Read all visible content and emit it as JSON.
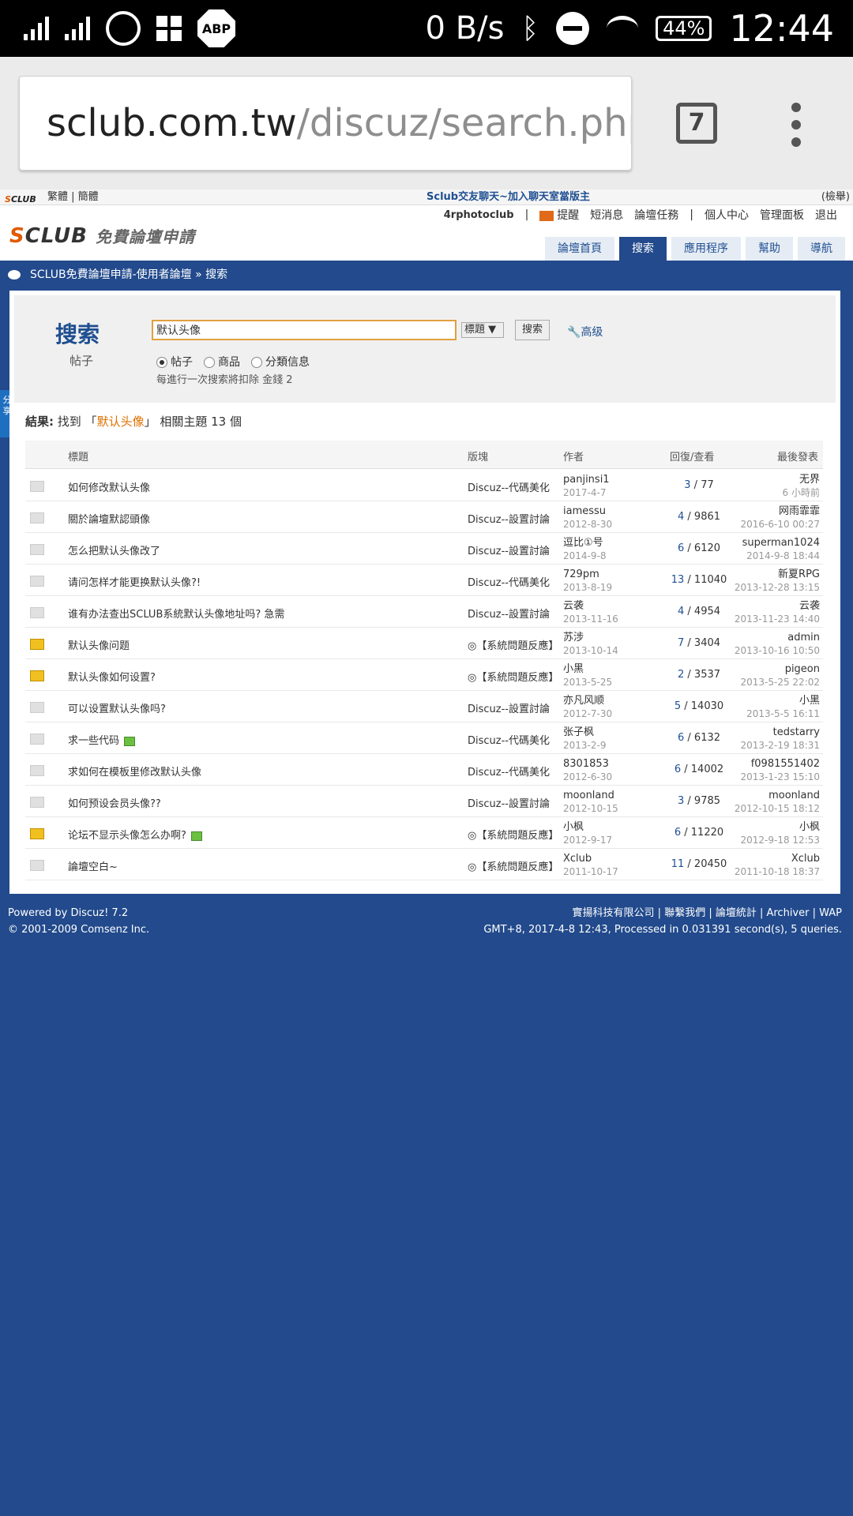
{
  "status_bar": {
    "bps": "0 B/s",
    "battery": "44%",
    "time": "12:44"
  },
  "browser": {
    "url_host": "sclub.com.tw",
    "url_path": "/discuz/search.php?",
    "tab_count": "7"
  },
  "topbar": {
    "lang": "繁體 | 簡體",
    "chat": "Sclub交友聊天~加入聊天室當版主",
    "search": "(檢舉)"
  },
  "header": {
    "user": "4rphotoclub",
    "links": [
      "提醒",
      "短消息",
      "論壇任務",
      "個人中心",
      "管理面板",
      "退出"
    ],
    "nav": [
      "論壇首頁",
      "搜索",
      "應用程序",
      "幫助",
      "導航"
    ]
  },
  "breadcrumb": "SCLUB免費論壇申請-使用者論壇 » 搜索",
  "search": {
    "title": "搜索",
    "subtitle": "帖子",
    "query": "默认头像",
    "scope": "標題 ▼",
    "button": "搜索",
    "advanced": "高级",
    "options": [
      "帖子",
      "商品",
      "分類信息"
    ],
    "note": "每進行一次搜索將扣除 金錢 2"
  },
  "results": {
    "prefix": "結果:",
    "mid": "找到 「",
    "keyword": "默认头像",
    "suffix": "」 相關主題 13 個"
  },
  "table": {
    "headers": [
      "標題",
      "版塊",
      "作者",
      "回復/查看",
      "最後發表"
    ],
    "rows": [
      {
        "title": "如何修改默认头像",
        "forum": "Discuz--代碼美化",
        "author": "panjinsi1",
        "date": "2017-4-7",
        "replies": "3",
        "views": "77",
        "last_user": "无界",
        "last_time": "6 小時前"
      },
      {
        "title": "關於論壇默認頭像",
        "forum": "Discuz--設置討論",
        "author": "iamessu",
        "date": "2012-8-30",
        "replies": "4",
        "views": "9861",
        "last_user": "网雨霏霏",
        "last_time": "2016-6-10 00:27"
      },
      {
        "title": "怎么把默认头像改了",
        "forum": "Discuz--設置討論",
        "author": "逗比①号",
        "date": "2014-9-8",
        "replies": "6",
        "views": "6120",
        "last_user": "superman1024",
        "last_time": "2014-9-8 18:44"
      },
      {
        "title": "请问怎样才能更换默认头像?!",
        "forum": "Discuz--代碼美化",
        "author": "729pm",
        "date": "2013-8-19",
        "replies": "13",
        "views": "11040",
        "last_user": "新夏RPG",
        "last_time": "2013-12-28 13:15"
      },
      {
        "title": "谁有办法查出SCLUB系統默认头像地址吗? 急需",
        "forum": "Discuz--設置討論",
        "author": "云袭",
        "date": "2013-11-16",
        "replies": "4",
        "views": "4954",
        "last_user": "云袭",
        "last_time": "2013-11-23 14:40"
      },
      {
        "title": "默认头像问题",
        "forum": "◎【系統問題反應】",
        "author": "苏涉",
        "date": "2013-10-14",
        "replies": "7",
        "views": "3404",
        "last_user": "admin",
        "last_time": "2013-10-16 10:50",
        "locked": true
      },
      {
        "title": "默认头像如何设置?",
        "forum": "◎【系統問題反應】",
        "author": "小黑",
        "date": "2013-5-25",
        "replies": "2",
        "views": "3537",
        "last_user": "pigeon",
        "last_time": "2013-5-25 22:02",
        "locked": true
      },
      {
        "title": "可以设置默认头像吗?",
        "forum": "Discuz--設置討論",
        "author": "亦凡风顺",
        "date": "2012-7-30",
        "replies": "5",
        "views": "14030",
        "last_user": "小黑",
        "last_time": "2013-5-5 16:11"
      },
      {
        "title": "求一些代码",
        "forum": "Discuz--代碼美化",
        "author": "张子枫",
        "date": "2013-2-9",
        "replies": "6",
        "views": "6132",
        "last_user": "tedstarry",
        "last_time": "2013-2-19 18:31",
        "attach": true
      },
      {
        "title": "求如何在模板里修改默认头像",
        "forum": "Discuz--代碼美化",
        "author": "8301853",
        "date": "2012-6-30",
        "replies": "6",
        "views": "14002",
        "last_user": "f0981551402",
        "last_time": "2013-1-23 15:10"
      },
      {
        "title": "如何预设会员头像??",
        "forum": "Discuz--設置討論",
        "author": "moonland",
        "date": "2012-10-15",
        "replies": "3",
        "views": "9785",
        "last_user": "moonland",
        "last_time": "2012-10-15 18:12"
      },
      {
        "title": "论坛不显示头像怎么办啊?",
        "forum": "◎【系統問題反應】",
        "author": "小枫",
        "date": "2012-9-17",
        "replies": "6",
        "views": "11220",
        "last_user": "小枫",
        "last_time": "2012-9-18 12:53",
        "locked": true,
        "attach": true
      },
      {
        "title": "論壇空白~",
        "forum": "◎【系統問題反應】",
        "author": "Xclub",
        "date": "2011-10-17",
        "replies": "11",
        "views": "20450",
        "last_user": "Xclub",
        "last_time": "2011-10-18 18:37"
      }
    ]
  },
  "footer": {
    "powered": "Powered by Discuz! 7.2",
    "copyright": "© 2001-2009 Comsenz Inc.",
    "links": "實揚科技有限公司 | 聯繫我們 | 論壇統計 | Archiver | WAP",
    "stats": "GMT+8, 2017-4-8 12:43, Processed in 0.031391 second(s), 5 queries."
  },
  "share_label": "分享"
}
